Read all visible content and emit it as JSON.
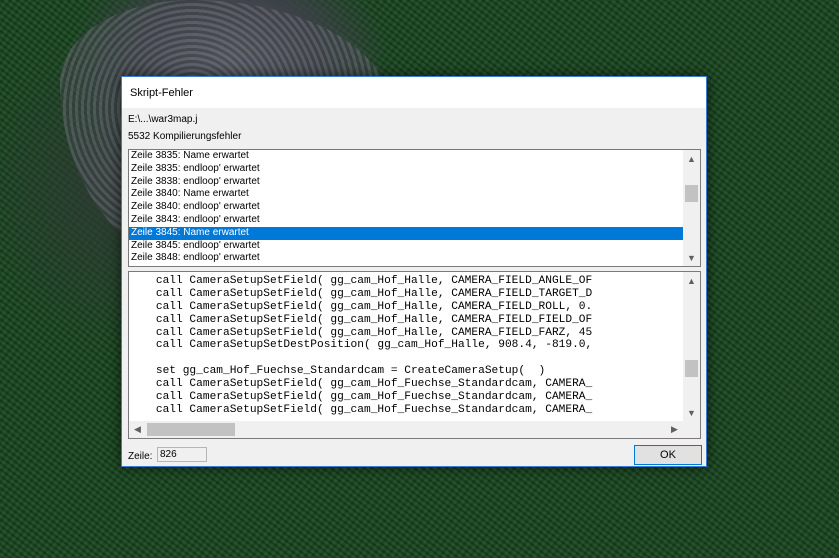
{
  "dialog": {
    "title": "Skript-Fehler",
    "path": "E:\\...\\war3map.j",
    "error_count": "5532 Kompilierungsfehler",
    "errors": [
      {
        "text": "Zeile 3835: Name erwartet",
        "selected": false
      },
      {
        "text": "Zeile 3835: endloop' erwartet",
        "selected": false
      },
      {
        "text": "Zeile 3838: endloop' erwartet",
        "selected": false
      },
      {
        "text": "Zeile 3840: Name erwartet",
        "selected": false
      },
      {
        "text": "Zeile 3840: endloop' erwartet",
        "selected": false
      },
      {
        "text": "Zeile 3843: endloop' erwartet",
        "selected": false
      },
      {
        "text": "Zeile 3845: Name erwartet",
        "selected": true
      },
      {
        "text": "Zeile 3845: endloop' erwartet",
        "selected": false
      },
      {
        "text": "Zeile 3848: endloop' erwartet",
        "selected": false
      }
    ],
    "code_lines": [
      "    call CameraSetupSetField( gg_cam_Hof_Halle, CAMERA_FIELD_ANGLE_OF",
      "    call CameraSetupSetField( gg_cam_Hof_Halle, CAMERA_FIELD_TARGET_D",
      "    call CameraSetupSetField( gg_cam_Hof_Halle, CAMERA_FIELD_ROLL, 0.",
      "    call CameraSetupSetField( gg_cam_Hof_Halle, CAMERA_FIELD_FIELD_OF",
      "    call CameraSetupSetField( gg_cam_Hof_Halle, CAMERA_FIELD_FARZ, 45",
      "    call CameraSetupSetDestPosition( gg_cam_Hof_Halle, 908.4, -819.0,",
      "",
      "    set gg_cam_Hof_Fuechse_Standardcam = CreateCameraSetup(  )",
      "    call CameraSetupSetField( gg_cam_Hof_Fuechse_Standardcam, CAMERA_",
      "    call CameraSetupSetField( gg_cam_Hof_Fuechse_Standardcam, CAMERA_",
      "    call CameraSetupSetField( gg_cam_Hof_Fuechse_Standardcam, CAMERA_"
    ],
    "line_label": "Zeile:",
    "line_value": "826",
    "ok_label": "OK",
    "icons": {
      "scroll_up": "▲",
      "scroll_down": "▼",
      "scroll_left": "◀",
      "scroll_right": "▶"
    }
  }
}
